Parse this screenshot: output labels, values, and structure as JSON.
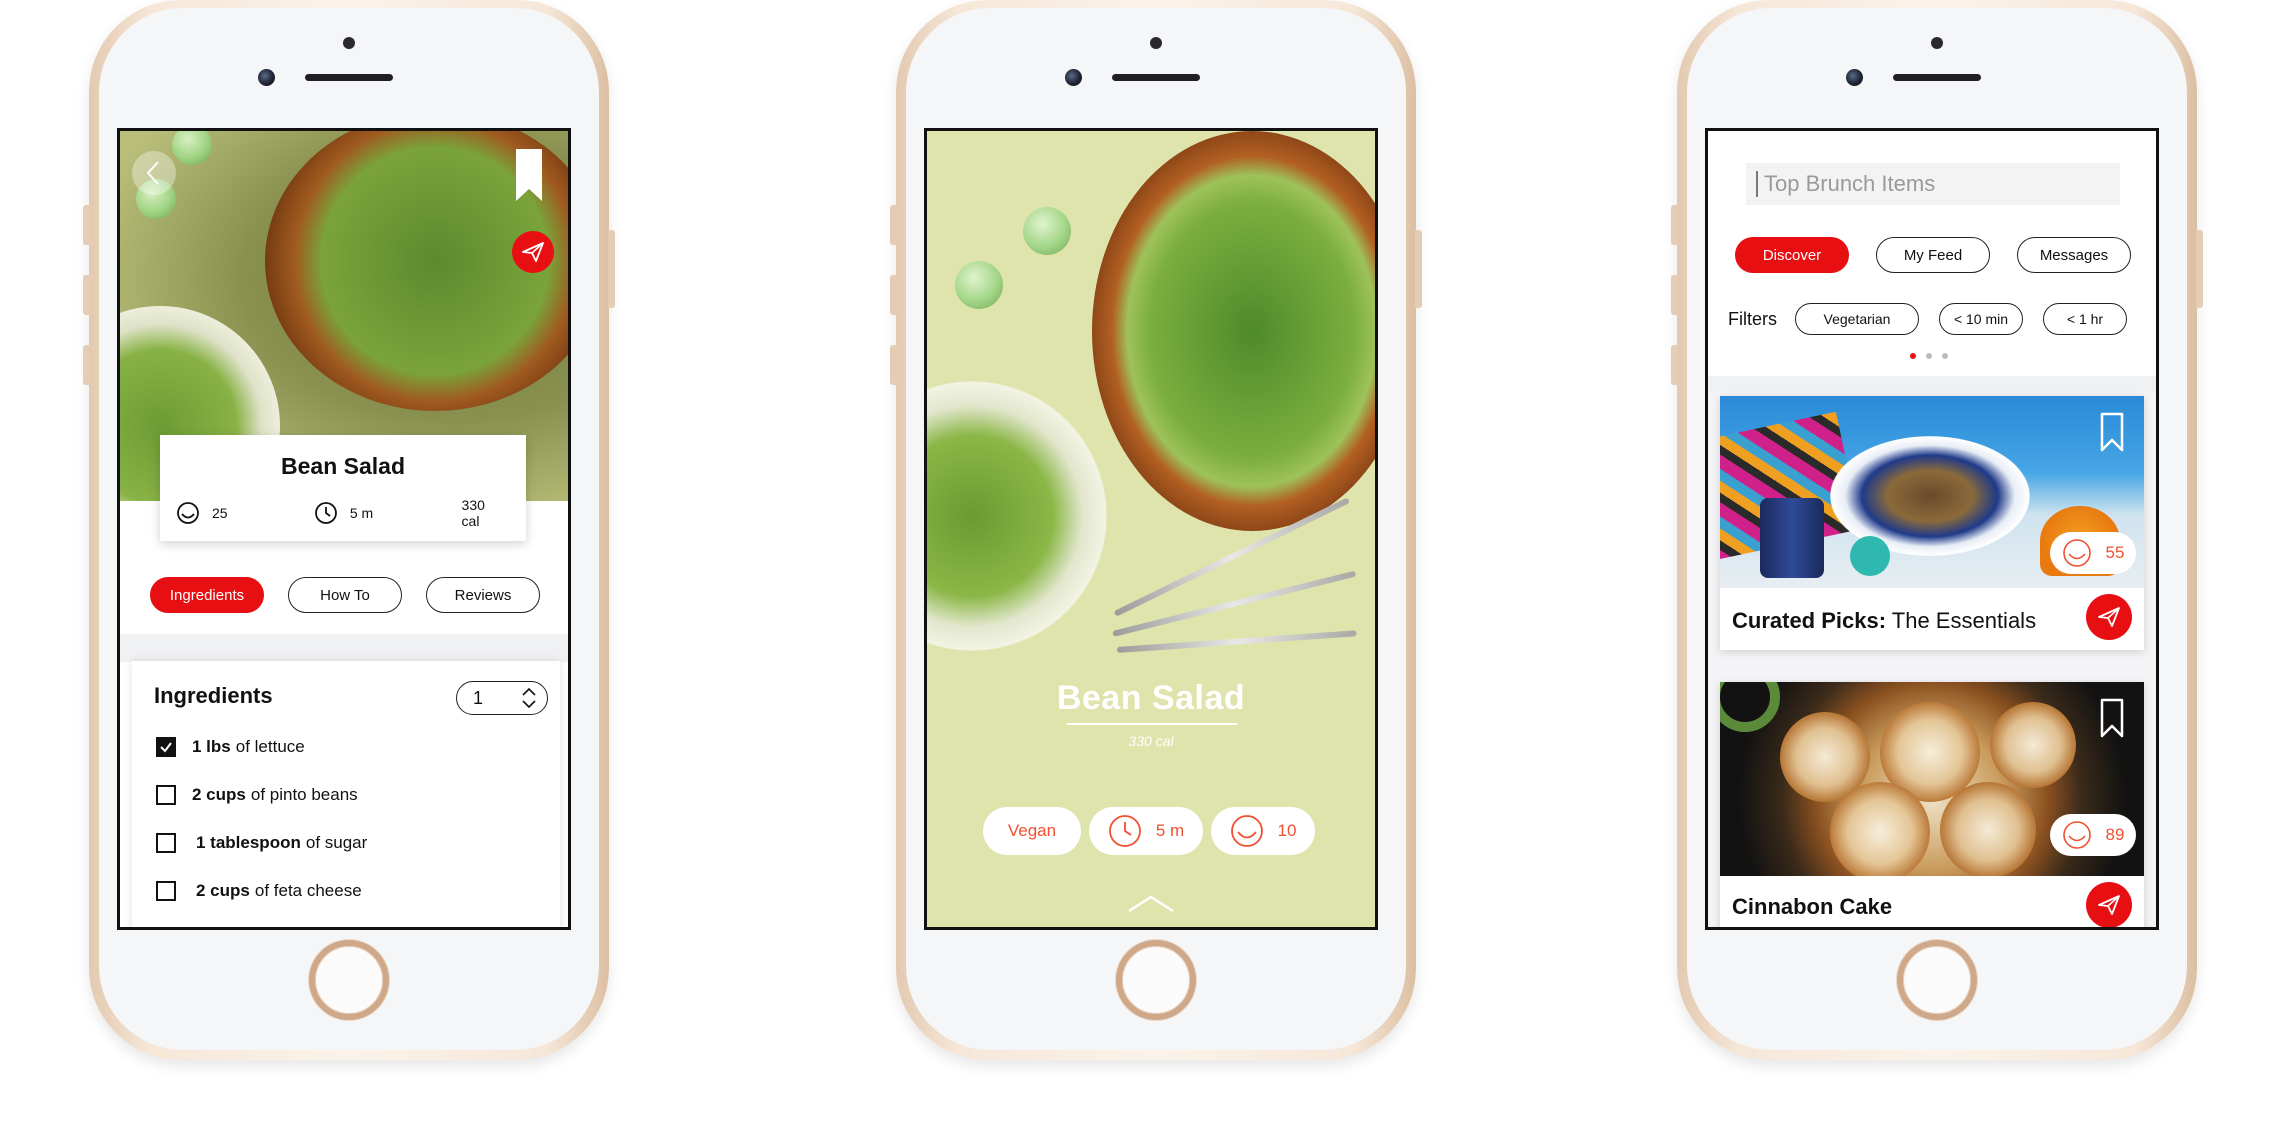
{
  "colors": {
    "accent": "#e80f13",
    "accent_text": "#f05030",
    "hero_green": "#dfe3ac"
  },
  "recipe_detail": {
    "title": "Bean Salad",
    "stats": {
      "likes": "25",
      "time": "5 m",
      "calories": "330 cal"
    },
    "tabs": [
      {
        "label": "Ingredients",
        "active": true
      },
      {
        "label": "How To",
        "active": false
      },
      {
        "label": "Reviews",
        "active": false
      }
    ],
    "ingredients_heading": "Ingredients",
    "servings": "1",
    "ingredients": [
      {
        "qty": "1 lbs",
        "rest": "of lettuce",
        "checked": true
      },
      {
        "qty": "2 cups",
        "rest": "of pinto beans",
        "checked": false
      },
      {
        "qty": "1 tablespoon",
        "rest": "of sugar",
        "checked": false
      },
      {
        "qty": "2 cups",
        "rest": "of feta cheese",
        "checked": false
      }
    ],
    "icons": [
      "back-icon",
      "bookmark-icon",
      "send-icon",
      "smiley-icon",
      "clock-icon",
      "stepper-arrows-icon",
      "checkmark-icon"
    ]
  },
  "recipe_hero": {
    "title": "Bean Salad",
    "calories": "330 cal",
    "chips": {
      "diet": "Vegan",
      "time": "5 m",
      "likes": "10"
    },
    "icons": [
      "clock-icon",
      "smiley-icon",
      "chevron-up-icon"
    ]
  },
  "feed": {
    "search_placeholder": "Top Brunch Items",
    "nav": [
      {
        "label": "Discover",
        "active": true
      },
      {
        "label": "My Feed",
        "active": false
      },
      {
        "label": "Messages",
        "active": false
      }
    ],
    "filters_label": "Filters",
    "filters": [
      "Vegetarian",
      "< 10 min",
      "< 1 hr"
    ],
    "page_dots": 3,
    "active_dot": 0,
    "cards": [
      {
        "title_bold": "Curated Picks:",
        "title_rest": "The Essentials",
        "likes": "55"
      },
      {
        "title_bold": "Cinnabon Cake",
        "title_rest": "",
        "likes": "89"
      }
    ],
    "icons": [
      "bookmark-outline-icon",
      "smiley-icon",
      "send-icon"
    ]
  }
}
